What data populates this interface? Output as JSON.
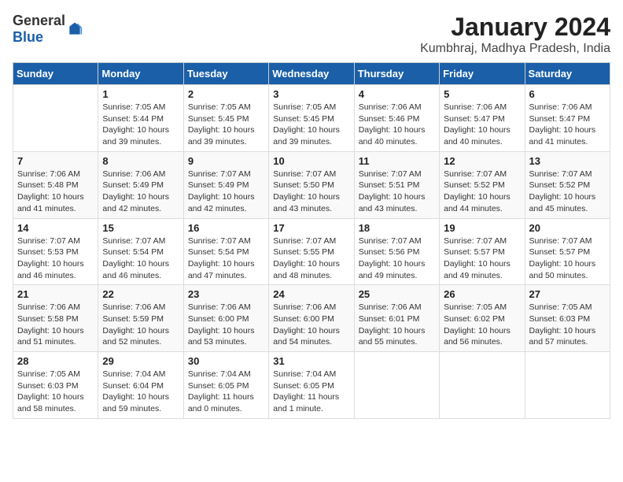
{
  "logo": {
    "general": "General",
    "blue": "Blue"
  },
  "title": "January 2024",
  "subtitle": "Kumbhraj, Madhya Pradesh, India",
  "headers": [
    "Sunday",
    "Monday",
    "Tuesday",
    "Wednesday",
    "Thursday",
    "Friday",
    "Saturday"
  ],
  "weeks": [
    [
      {
        "day": "",
        "info": ""
      },
      {
        "day": "1",
        "info": "Sunrise: 7:05 AM\nSunset: 5:44 PM\nDaylight: 10 hours\nand 39 minutes."
      },
      {
        "day": "2",
        "info": "Sunrise: 7:05 AM\nSunset: 5:45 PM\nDaylight: 10 hours\nand 39 minutes."
      },
      {
        "day": "3",
        "info": "Sunrise: 7:05 AM\nSunset: 5:45 PM\nDaylight: 10 hours\nand 39 minutes."
      },
      {
        "day": "4",
        "info": "Sunrise: 7:06 AM\nSunset: 5:46 PM\nDaylight: 10 hours\nand 40 minutes."
      },
      {
        "day": "5",
        "info": "Sunrise: 7:06 AM\nSunset: 5:47 PM\nDaylight: 10 hours\nand 40 minutes."
      },
      {
        "day": "6",
        "info": "Sunrise: 7:06 AM\nSunset: 5:47 PM\nDaylight: 10 hours\nand 41 minutes."
      }
    ],
    [
      {
        "day": "7",
        "info": "Sunrise: 7:06 AM\nSunset: 5:48 PM\nDaylight: 10 hours\nand 41 minutes."
      },
      {
        "day": "8",
        "info": "Sunrise: 7:06 AM\nSunset: 5:49 PM\nDaylight: 10 hours\nand 42 minutes."
      },
      {
        "day": "9",
        "info": "Sunrise: 7:07 AM\nSunset: 5:49 PM\nDaylight: 10 hours\nand 42 minutes."
      },
      {
        "day": "10",
        "info": "Sunrise: 7:07 AM\nSunset: 5:50 PM\nDaylight: 10 hours\nand 43 minutes."
      },
      {
        "day": "11",
        "info": "Sunrise: 7:07 AM\nSunset: 5:51 PM\nDaylight: 10 hours\nand 43 minutes."
      },
      {
        "day": "12",
        "info": "Sunrise: 7:07 AM\nSunset: 5:52 PM\nDaylight: 10 hours\nand 44 minutes."
      },
      {
        "day": "13",
        "info": "Sunrise: 7:07 AM\nSunset: 5:52 PM\nDaylight: 10 hours\nand 45 minutes."
      }
    ],
    [
      {
        "day": "14",
        "info": "Sunrise: 7:07 AM\nSunset: 5:53 PM\nDaylight: 10 hours\nand 46 minutes."
      },
      {
        "day": "15",
        "info": "Sunrise: 7:07 AM\nSunset: 5:54 PM\nDaylight: 10 hours\nand 46 minutes."
      },
      {
        "day": "16",
        "info": "Sunrise: 7:07 AM\nSunset: 5:54 PM\nDaylight: 10 hours\nand 47 minutes."
      },
      {
        "day": "17",
        "info": "Sunrise: 7:07 AM\nSunset: 5:55 PM\nDaylight: 10 hours\nand 48 minutes."
      },
      {
        "day": "18",
        "info": "Sunrise: 7:07 AM\nSunset: 5:56 PM\nDaylight: 10 hours\nand 49 minutes."
      },
      {
        "day": "19",
        "info": "Sunrise: 7:07 AM\nSunset: 5:57 PM\nDaylight: 10 hours\nand 49 minutes."
      },
      {
        "day": "20",
        "info": "Sunrise: 7:07 AM\nSunset: 5:57 PM\nDaylight: 10 hours\nand 50 minutes."
      }
    ],
    [
      {
        "day": "21",
        "info": "Sunrise: 7:06 AM\nSunset: 5:58 PM\nDaylight: 10 hours\nand 51 minutes."
      },
      {
        "day": "22",
        "info": "Sunrise: 7:06 AM\nSunset: 5:59 PM\nDaylight: 10 hours\nand 52 minutes."
      },
      {
        "day": "23",
        "info": "Sunrise: 7:06 AM\nSunset: 6:00 PM\nDaylight: 10 hours\nand 53 minutes."
      },
      {
        "day": "24",
        "info": "Sunrise: 7:06 AM\nSunset: 6:00 PM\nDaylight: 10 hours\nand 54 minutes."
      },
      {
        "day": "25",
        "info": "Sunrise: 7:06 AM\nSunset: 6:01 PM\nDaylight: 10 hours\nand 55 minutes."
      },
      {
        "day": "26",
        "info": "Sunrise: 7:05 AM\nSunset: 6:02 PM\nDaylight: 10 hours\nand 56 minutes."
      },
      {
        "day": "27",
        "info": "Sunrise: 7:05 AM\nSunset: 6:03 PM\nDaylight: 10 hours\nand 57 minutes."
      }
    ],
    [
      {
        "day": "28",
        "info": "Sunrise: 7:05 AM\nSunset: 6:03 PM\nDaylight: 10 hours\nand 58 minutes."
      },
      {
        "day": "29",
        "info": "Sunrise: 7:04 AM\nSunset: 6:04 PM\nDaylight: 10 hours\nand 59 minutes."
      },
      {
        "day": "30",
        "info": "Sunrise: 7:04 AM\nSunset: 6:05 PM\nDaylight: 11 hours\nand 0 minutes."
      },
      {
        "day": "31",
        "info": "Sunrise: 7:04 AM\nSunset: 6:05 PM\nDaylight: 11 hours\nand 1 minute."
      },
      {
        "day": "",
        "info": ""
      },
      {
        "day": "",
        "info": ""
      },
      {
        "day": "",
        "info": ""
      }
    ]
  ]
}
